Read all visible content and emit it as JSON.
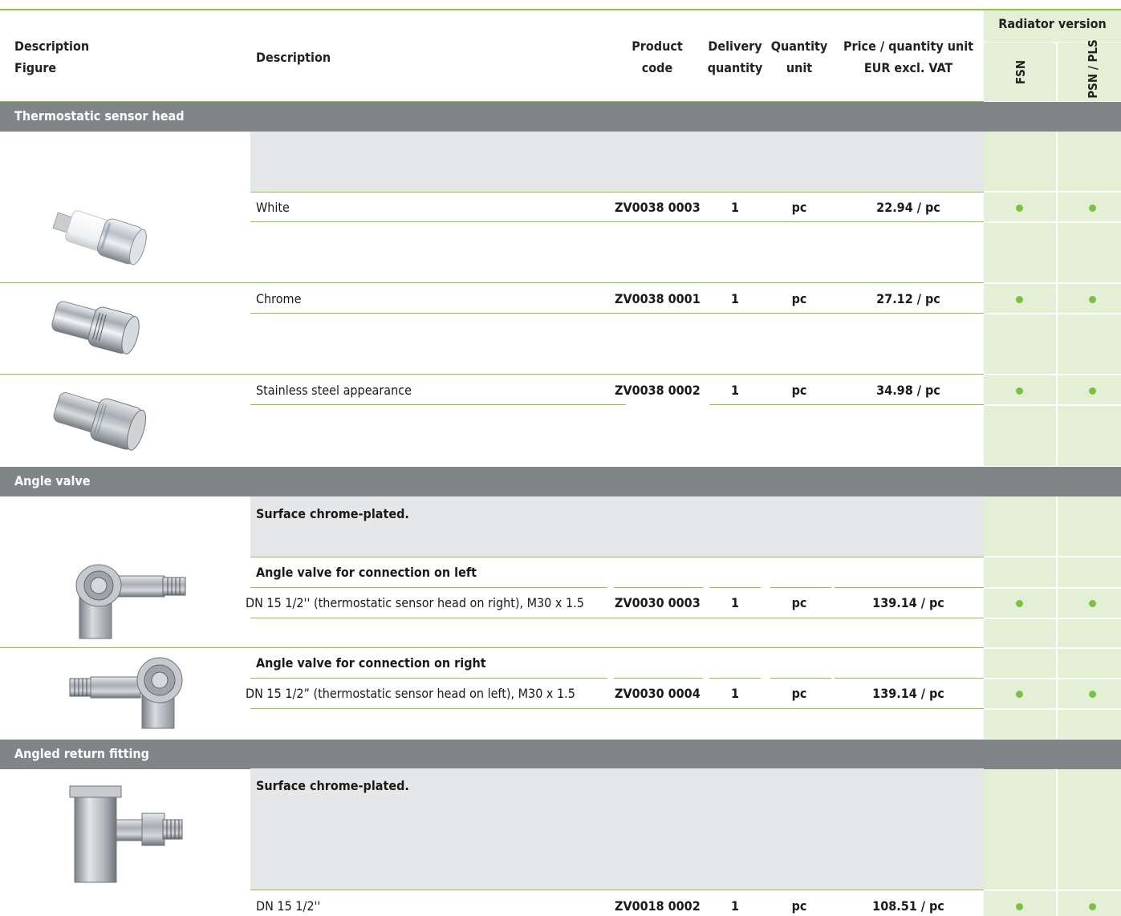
{
  "header": {
    "col1_line1": "Description",
    "col1_line2": "Figure",
    "col2": "Description",
    "product_code_1": "Product",
    "product_code_2": "code",
    "delivery_1": "Delivery",
    "delivery_2": "quantity",
    "qty_unit_1": "Quantity",
    "qty_unit_2": "unit",
    "price_1": "Price / quantity unit",
    "price_2": "EUR excl. VAT",
    "radiator_version": "Radiator version",
    "fsn": "FSN",
    "psn_pls": "PSN / PLS"
  },
  "sections": {
    "thermo": "Thermostatic sensor head",
    "angle": "Angle valve",
    "return": "Angled return fitting"
  },
  "notes": {
    "angle_surface": "Surface chrome-plated.",
    "return_surface": "Surface chrome-plated."
  },
  "subheads": {
    "left_conn": "Angle valve for connection on left",
    "right_conn": "Angle valve for connection on right"
  },
  "rows": [
    {
      "desc": "White",
      "code": "ZV0038 0003",
      "qty": "1",
      "unit": "pc",
      "price": "22.94 / pc"
    },
    {
      "desc": "Chrome",
      "code": "ZV0038 0001",
      "qty": "1",
      "unit": "pc",
      "price": "27.12 / pc"
    },
    {
      "desc": "Stainless steel appearance",
      "code": "ZV0038 0002",
      "qty": "1",
      "unit": "pc",
      "price": "34.98 / pc"
    },
    {
      "desc": "DN 15 1/2'' (thermostatic sensor head on right), M30 x 1.5",
      "code": "ZV0030 0003",
      "qty": "1",
      "unit": "pc",
      "price": "139.14 / pc"
    },
    {
      "desc": "DN 15 1/2” (thermostatic sensor head on left), M30 x 1.5",
      "code": "ZV0030 0004",
      "qty": "1",
      "unit": "pc",
      "price": "139.14 / pc"
    },
    {
      "desc": "DN 15 1/2''",
      "code": "ZV0018 0002",
      "qty": "1",
      "unit": "pc",
      "price": "108.51 / pc"
    }
  ],
  "colors": {
    "accent_green": "#8cc63f",
    "dot_green": "#7ac143",
    "section_grey": "#808587",
    "column_green": "#e3f0d5"
  },
  "icons": [
    "white-sensor-head-image",
    "chrome-sensor-head-image",
    "steel-sensor-head-image",
    "angle-valve-left-image",
    "angle-valve-right-image",
    "angled-return-fitting-image",
    "availability-dot-icon"
  ]
}
